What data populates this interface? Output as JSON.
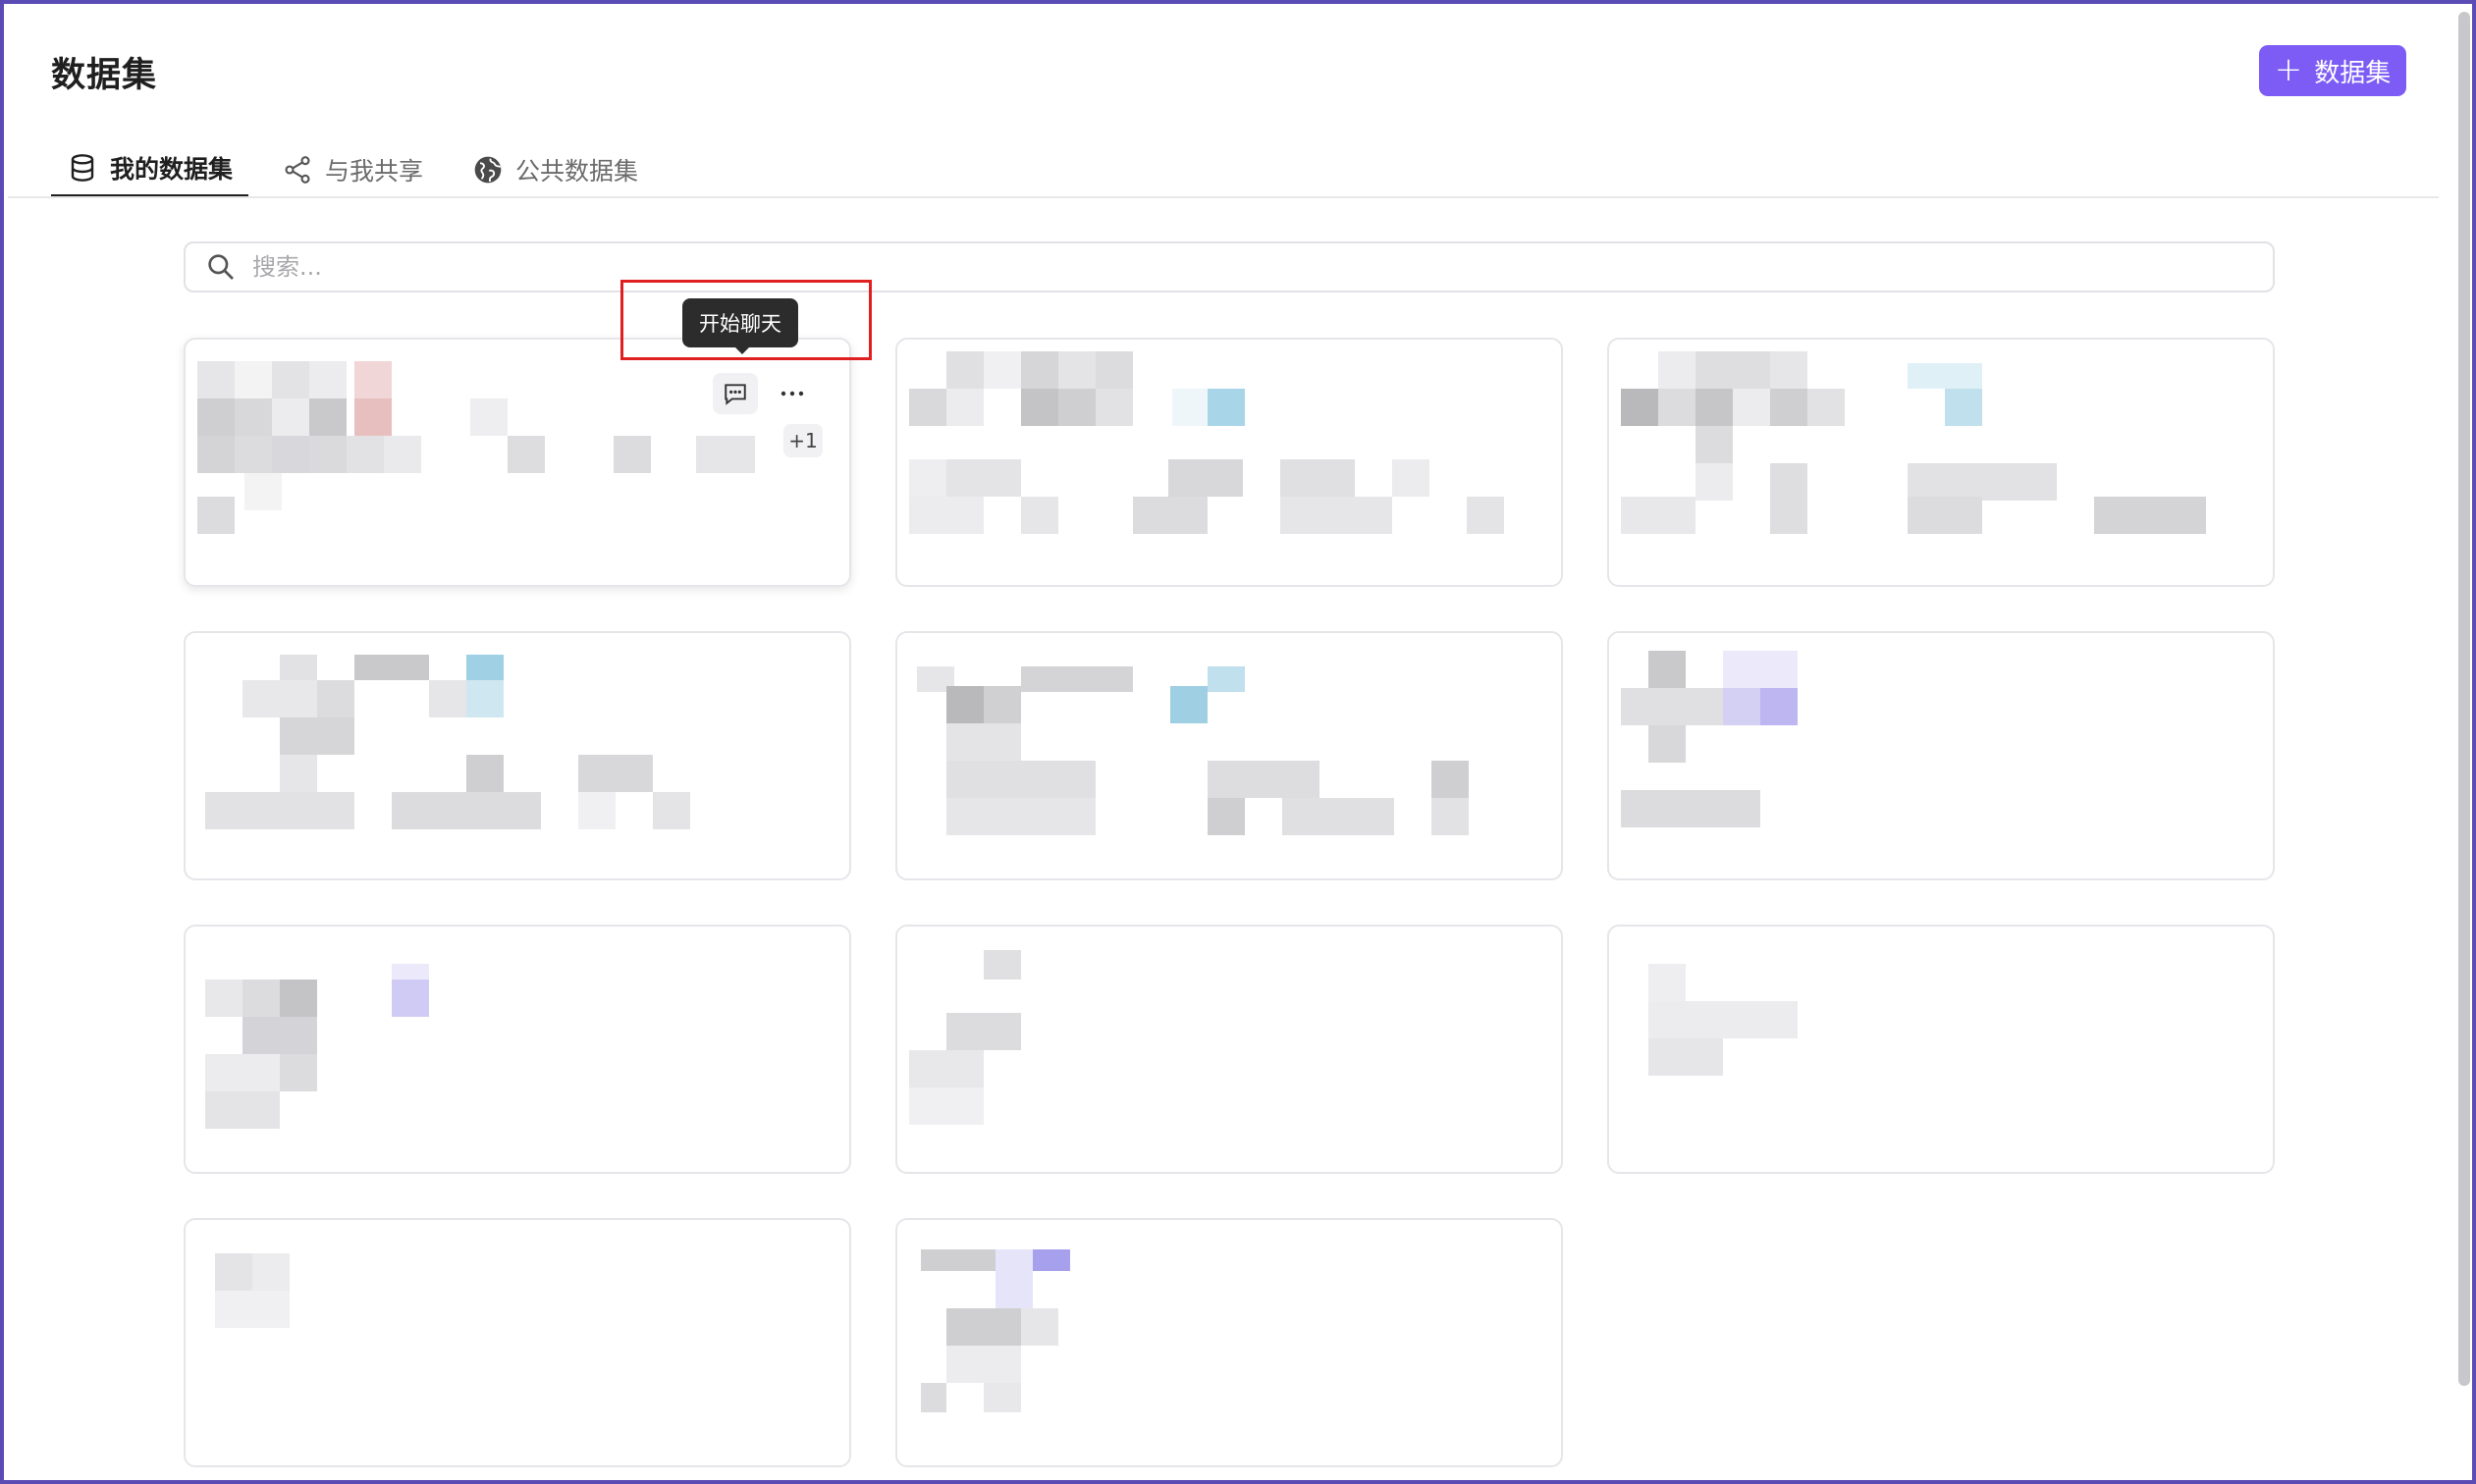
{
  "page": {
    "title": "数据集",
    "add_button_label": "数据集"
  },
  "tabs": [
    {
      "label": "我的数据集",
      "icon": "database-icon",
      "active": true
    },
    {
      "label": "与我共享",
      "icon": "share-icon",
      "active": false
    },
    {
      "label": "公共数据集",
      "icon": "globe-icon",
      "active": false
    }
  ],
  "search": {
    "placeholder": "搜索..."
  },
  "hovered_card": {
    "tooltip": "开始聊天",
    "chat_icon": "chat-bubble-icon",
    "more_icon": "more-horizontal-icon",
    "tag_overflow": "+1"
  },
  "cards_count": 11,
  "colors": {
    "accent": "#7c5cf4",
    "highlight": "#e02020",
    "frame": "#5b4bb4"
  }
}
